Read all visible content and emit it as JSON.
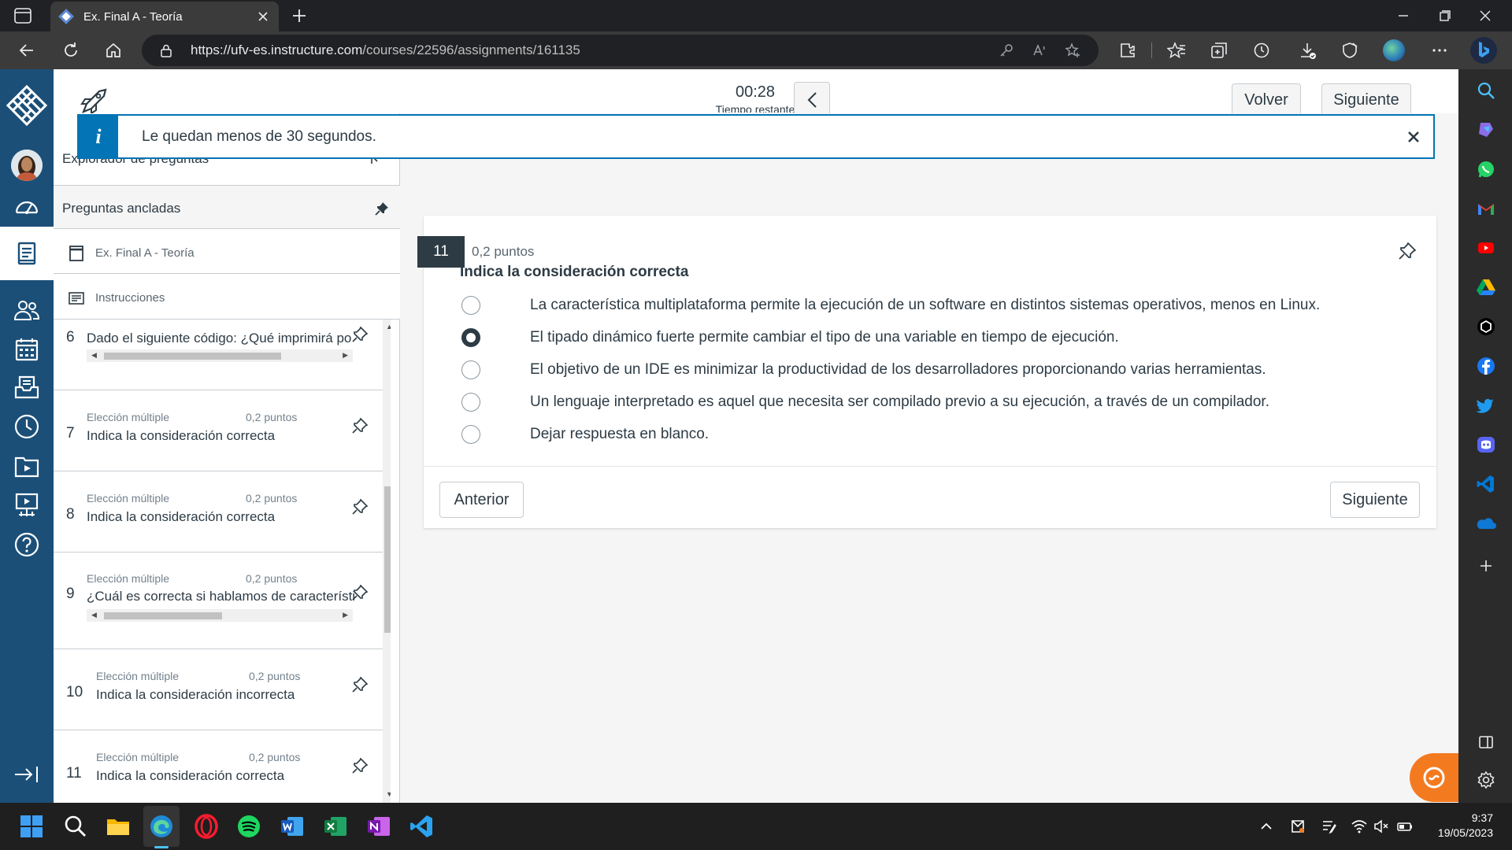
{
  "browser": {
    "tab_title": "Ex. Final A - Teoría",
    "url_host": "https://ufv-es.instructure.com",
    "url_path": "/courses/22596/assignments/161135"
  },
  "header": {
    "timer_value": "00:28",
    "timer_label": "Tiempo restante",
    "back_label": "Volver",
    "next_label": "Siguiente"
  },
  "alert": {
    "icon": "i",
    "message": "Le quedan menos de 30 segundos."
  },
  "left_panel": {
    "header_title": "Explorador de preguntas",
    "pinned_label": "Preguntas ancladas",
    "links": [
      {
        "label": "Ex. Final A - Teoría",
        "icon": "document-icon"
      },
      {
        "label": "Instrucciones",
        "icon": "list-icon"
      }
    ],
    "questions": [
      {
        "number": "6",
        "type": "Elección múltiple",
        "points": "0,2 puntos",
        "text": "Dado el siguiente código: ¿Qué imprimirá po",
        "scroll_fraction": 0.75
      },
      {
        "number": "7",
        "type": "Elección múltiple",
        "points": "0,2 puntos",
        "text": "Indica la consideración correcta"
      },
      {
        "number": "8",
        "type": "Elección múltiple",
        "points": "0,2 puntos",
        "text": "Indica la consideración correcta"
      },
      {
        "number": "9",
        "type": "Elección múltiple",
        "points": "0,2 puntos",
        "text": "¿Cuál es correcta si hablamos de característi",
        "scroll_fraction": 0.5
      },
      {
        "number": "10",
        "type": "Elección múltiple",
        "points": "0,2 puntos",
        "text": "Indica la consideración incorrecta"
      },
      {
        "number": "11",
        "type": "Elección múltiple",
        "points": "0,2 puntos",
        "text": "Indica la consideración correcta"
      }
    ]
  },
  "question": {
    "number": "11",
    "points": "0,2 puntos",
    "title": "Indica la consideración correcta",
    "answers": [
      {
        "text": "La característica multiplataforma permite la ejecución de un software en distintos sistemas operativos, menos en Linux.",
        "selected": false
      },
      {
        "text": "El tipado dinámico fuerte permite cambiar el tipo de una variable en tiempo de ejecución.",
        "selected": true
      },
      {
        "text": "El objetivo de un IDE es minimizar la productividad de los desarrolladores proporcionando varias herramientas.",
        "selected": false
      },
      {
        "text": "Un lenguaje interpretado es aquel que necesita ser compilado previo a su ejecución, a través de un compilador.",
        "selected": false
      },
      {
        "text": "Dejar respuesta en blanco.",
        "selected": false
      }
    ],
    "prev_label": "Anterior",
    "next_label": "Siguiente"
  },
  "taskbar": {
    "time": "9:37",
    "date": "19/05/2023"
  },
  "colors": {
    "canvas_nav": "#1b4f78",
    "alert_blue": "#0374b5",
    "text_dark": "#2d3b45",
    "help_orange": "#f47a20"
  }
}
